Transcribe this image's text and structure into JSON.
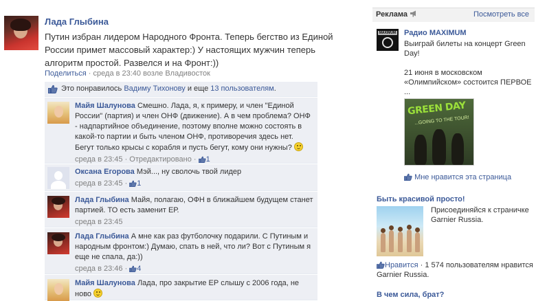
{
  "post": {
    "author": "Лада Глыбина",
    "text": "Путин избран лидером Народного Фронта. Теперь бегство из Единой России примет массовый характер:) У настоящих мужчин теперь алгоритм простой. Развелся и на Фронт:))",
    "share_label": "Поделиться",
    "separator": " · ",
    "time": "среда в 23:40 возле Владивосток"
  },
  "likes": {
    "prefix": "Это понравилось ",
    "person": "Вадиму Тихонову",
    "middle": " и еще ",
    "others": "13 пользователям",
    "suffix": "."
  },
  "comments": [
    {
      "author": "Майя Шалунова",
      "text": "Смешно. Лада, я, к примеру, и член \"Единой России\" (партия) и член ОНФ (движение). А в чем проблема? ОНФ - надпартийное объединение, поэтому вполне можно состоять в какой-то партии и быть членом ОНФ, противоречия здесь нет. Бегут только крысы с корабля и пусть бегут, кому они нужны?",
      "time": "среда в 23:45",
      "edited": "Отредактировано",
      "likes": "1"
    },
    {
      "author": "Оксана Егорова",
      "text": "Мэй..., ну сволочь твой лидер",
      "time": "среда в 23:45",
      "likes": "1"
    },
    {
      "author": "Лада Глыбина",
      "text": "Майя, полагаю, ОФН в ближайшем будущем станет партией. ТО есть заменит ЕР.",
      "time": "среда в 23:45"
    },
    {
      "author": "Лада Глыбина",
      "text": "А мне как раз футболочку подарили. С Путиным и народным фронтом:) Думаю, спать в ней, что ли? Вот с Путиным я еще не спала, да:))",
      "time": "среда в 23:46",
      "likes": "4"
    },
    {
      "author": "Майя Шалунова",
      "text": "Лада, про закрытие ЕР слышу с 2006 года, не ново"
    }
  ],
  "sidebar": {
    "header_title": "Реклама",
    "header_more": "Посмотреть все",
    "ad1": {
      "logo_text": "MAXIMUM",
      "title": "Радио MAXIMUM",
      "text1": "Выиграй билеты на концерт Green Day!",
      "text2": "21 июня в московском «Олимпийском» состоится ПЕРВОЕ ...",
      "image_title": "GREEN DAY",
      "image_subtitle": "...GOING TO THE TOUR!",
      "like_label": "Мне нравится эта страница"
    },
    "ad2": {
      "title": "Быть красивой просто!",
      "text": "Присоединяйся к страничке Garnier Russia.",
      "like_label": "Нравится",
      "separator": " · ",
      "count_text": "1 574 пользователям нравится Garnier Russia."
    },
    "ad3": {
      "title": "В чем сила, брат?"
    }
  },
  "colors": {
    "link": "#3b5998",
    "comment_bg": "#edeff4",
    "muted": "#808080"
  },
  "icons": [
    "thumbs-up-icon",
    "megaphone-icon",
    "smiley-icon"
  ]
}
